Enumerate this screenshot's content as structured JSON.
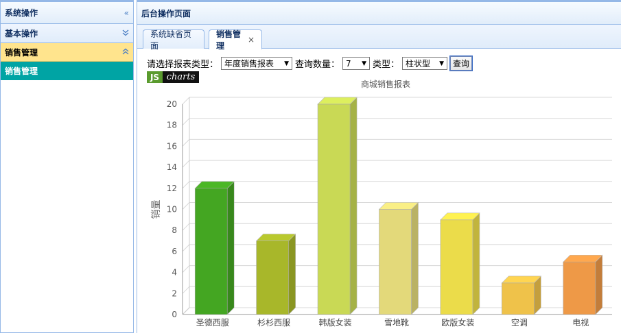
{
  "sidebar": {
    "title": "系统操作",
    "collapse_icon": "double-chevron-left-icon",
    "groups": [
      {
        "label": "基本操作",
        "icon": "double-chevron-down-icon"
      },
      {
        "label": "销售管理",
        "icon": "double-chevron-up-icon",
        "active": true
      }
    ],
    "items": [
      {
        "label": "销售管理",
        "selected": true
      }
    ]
  },
  "main": {
    "title": "后台操作页面",
    "tabs": [
      {
        "label": "系统缺省页面",
        "active": false
      },
      {
        "label": "销售管理",
        "active": true,
        "close": "×"
      }
    ]
  },
  "filters": {
    "report_type_label": "请选择报表类型：",
    "report_type_value": "年度销售报表",
    "count_label": "查询数量：",
    "count_value": "7",
    "chart_type_label": "类型：",
    "chart_type_value": "柱状型",
    "query_button": "查询"
  },
  "logo": {
    "part1": "JS",
    "part2": "charts"
  },
  "colors": {
    "accent_blue": "#95b8e7",
    "active_group": "#ffe48d",
    "selected_item": "#00a4a4"
  },
  "chart_data": {
    "type": "bar",
    "title": "商城销售报表",
    "ylabel": "销量",
    "xlabel": "",
    "ylim": [
      0,
      20
    ],
    "yticks": [
      0,
      2,
      4,
      6,
      8,
      10,
      12,
      14,
      16,
      18,
      20
    ],
    "grid": true,
    "categories": [
      "圣德西服",
      "杉杉西服",
      "韩版女装",
      "雪地靴",
      "欧版女装",
      "空调",
      "电视"
    ],
    "values": [
      12,
      7,
      20,
      10,
      9,
      3,
      5
    ],
    "colors": [
      "#44a622",
      "#a8b72a",
      "#c9d955",
      "#e3d97a",
      "#ebdc4a",
      "#efc24a",
      "#ee9947"
    ]
  }
}
